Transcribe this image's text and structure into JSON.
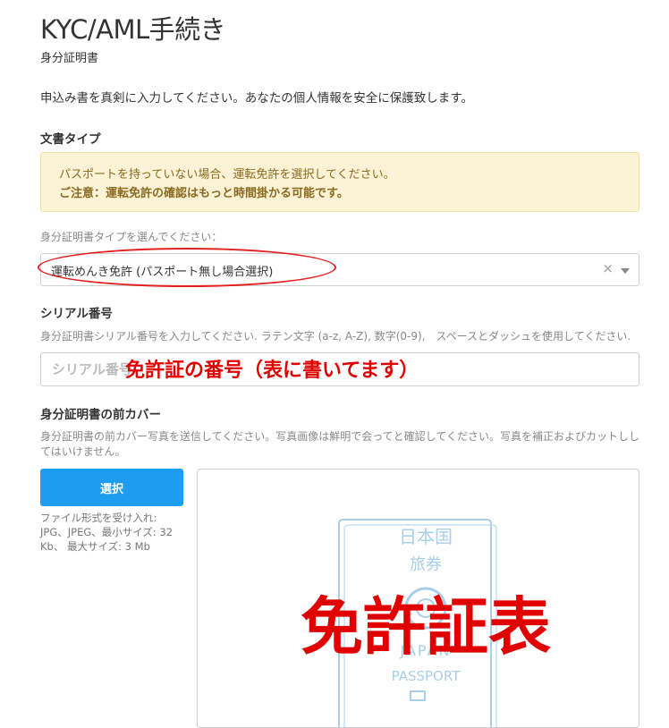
{
  "page": {
    "title": "KYC/AML手続き",
    "subtitle": "身分証明書",
    "intro": "申込み書を真剣に入力してください。あなたの個人情報を安全に保護致します。"
  },
  "document_type": {
    "label": "文書タイプ",
    "notice_line1": "パスポートを持っていない場合、運転免許を選択してください。",
    "notice_line2": "ご注意：運転免許の確認はもっと時間掛かる可能です。",
    "select_hint": "身分証明書タイプを選んでください：",
    "selected_value": "運転めんき免許 (パスポート無し場合選択)",
    "clear_symbol": "×"
  },
  "serial": {
    "label": "シリアル番号",
    "hint": "身分証明書シリアル番号を入力してください. ラテン文字 (a-z, A-Z), 数字(0-9),　スペースとダッシュを使用してください.",
    "placeholder": "シリアル番号"
  },
  "front_cover": {
    "label": "身分証明書の前カバー",
    "hint_line1": "身分証明書の前カバー写真を送信してください。写真画像は鮮明で会ってと確認してください。写真を補正およびカットしし",
    "hint_line2": "てはいけません。",
    "button_label": "選択",
    "file_info_line1": "ファイル形式を受け入れ:",
    "file_info_line2": "JPG、JPEG、最小サイズ: 32",
    "file_info_line3": "Kb、 最大サイズ: 3 Mb"
  },
  "passport_image": {
    "top_text": "日本国",
    "mid_text": "旅券",
    "country": "JAPAN",
    "label": "PASSPORT",
    "color": "#a9cfe8"
  },
  "annotations": {
    "serial_note": "免許証の番号（表に書いてます）",
    "image_note": "免許証表",
    "color": "#e00000"
  }
}
